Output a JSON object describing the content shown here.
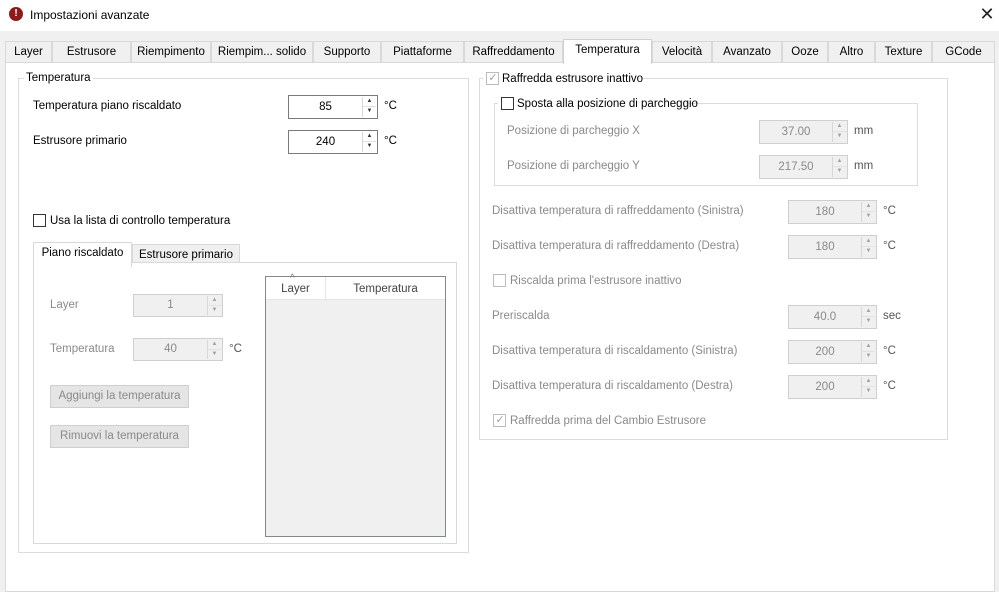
{
  "window": {
    "title": "Impostazioni avanzate",
    "icon": "app-logo-icon",
    "close_glyph": "✕"
  },
  "tabs": [
    {
      "label": "Layer"
    },
    {
      "label": "Estrusore"
    },
    {
      "label": "Riempimento"
    },
    {
      "label": "Riempim... solido"
    },
    {
      "label": "Supporto"
    },
    {
      "label": "Piattaforme"
    },
    {
      "label": "Raffreddamento"
    },
    {
      "label": "Temperatura"
    },
    {
      "label": "Velocità"
    },
    {
      "label": "Avanzato"
    },
    {
      "label": "Ooze"
    },
    {
      "label": "Altro"
    },
    {
      "label": "Texture"
    },
    {
      "label": "GCode"
    }
  ],
  "active_tab": "Temperatura",
  "temperature_group": {
    "legend": "Temperatura",
    "bed_label": "Temperatura piano riscaldato",
    "bed_value": "85",
    "bed_unit": "°C",
    "primary_label": "Estrusore primario",
    "primary_value": "240",
    "primary_unit": "°C",
    "use_list_label": "Usa la lista di controllo temperatura",
    "use_list_checked": false,
    "subtabs": [
      {
        "label": "Piano riscaldato"
      },
      {
        "label": "Estrusore primario"
      }
    ],
    "layer_label": "Layer",
    "layer_value": "1",
    "temp_label": "Temperatura",
    "temp_value": "40",
    "temp_unit": "°C",
    "add_button": "Aggiungi la temperatura",
    "remove_button": "Rimuovi la temperatura",
    "table": {
      "columns": [
        "Layer",
        "Temperatura"
      ],
      "sort_glyph": "^",
      "rows": []
    }
  },
  "cool_group": {
    "legend": "Raffredda estrusore inattivo",
    "checked": true,
    "park": {
      "legend": "Sposta alla posizione di parcheggio",
      "checked": false,
      "x_label": "Posizione di parcheggio X",
      "x_value": "37.00",
      "x_unit": "mm",
      "y_label": "Posizione di parcheggio Y",
      "y_value": "217.50",
      "y_unit": "mm"
    },
    "rows": [
      {
        "label": "Disattiva temperatura di raffreddamento (Sinistra)",
        "value": "180",
        "unit": "°C"
      },
      {
        "label": "Disattiva temperatura di raffreddamento (Destra)",
        "value": "180",
        "unit": "°C"
      }
    ],
    "preheat_label": "Riscalda prima l'estrusore inattivo",
    "preheat_checked": false,
    "rows2": [
      {
        "label": "Preriscalda",
        "value": "40.0",
        "unit": "sec"
      },
      {
        "label": "Disattiva temperatura di riscaldamento (Sinistra)",
        "value": "200",
        "unit": "°C"
      },
      {
        "label": "Disattiva temperatura di riscaldamento (Destra)",
        "value": "200",
        "unit": "°C"
      }
    ],
    "cool_before_label": "Raffredda prima del Cambio Estrusore",
    "cool_before_checked": true
  },
  "glyphs": {
    "up": "▲",
    "down": "▼",
    "check": "✓"
  }
}
